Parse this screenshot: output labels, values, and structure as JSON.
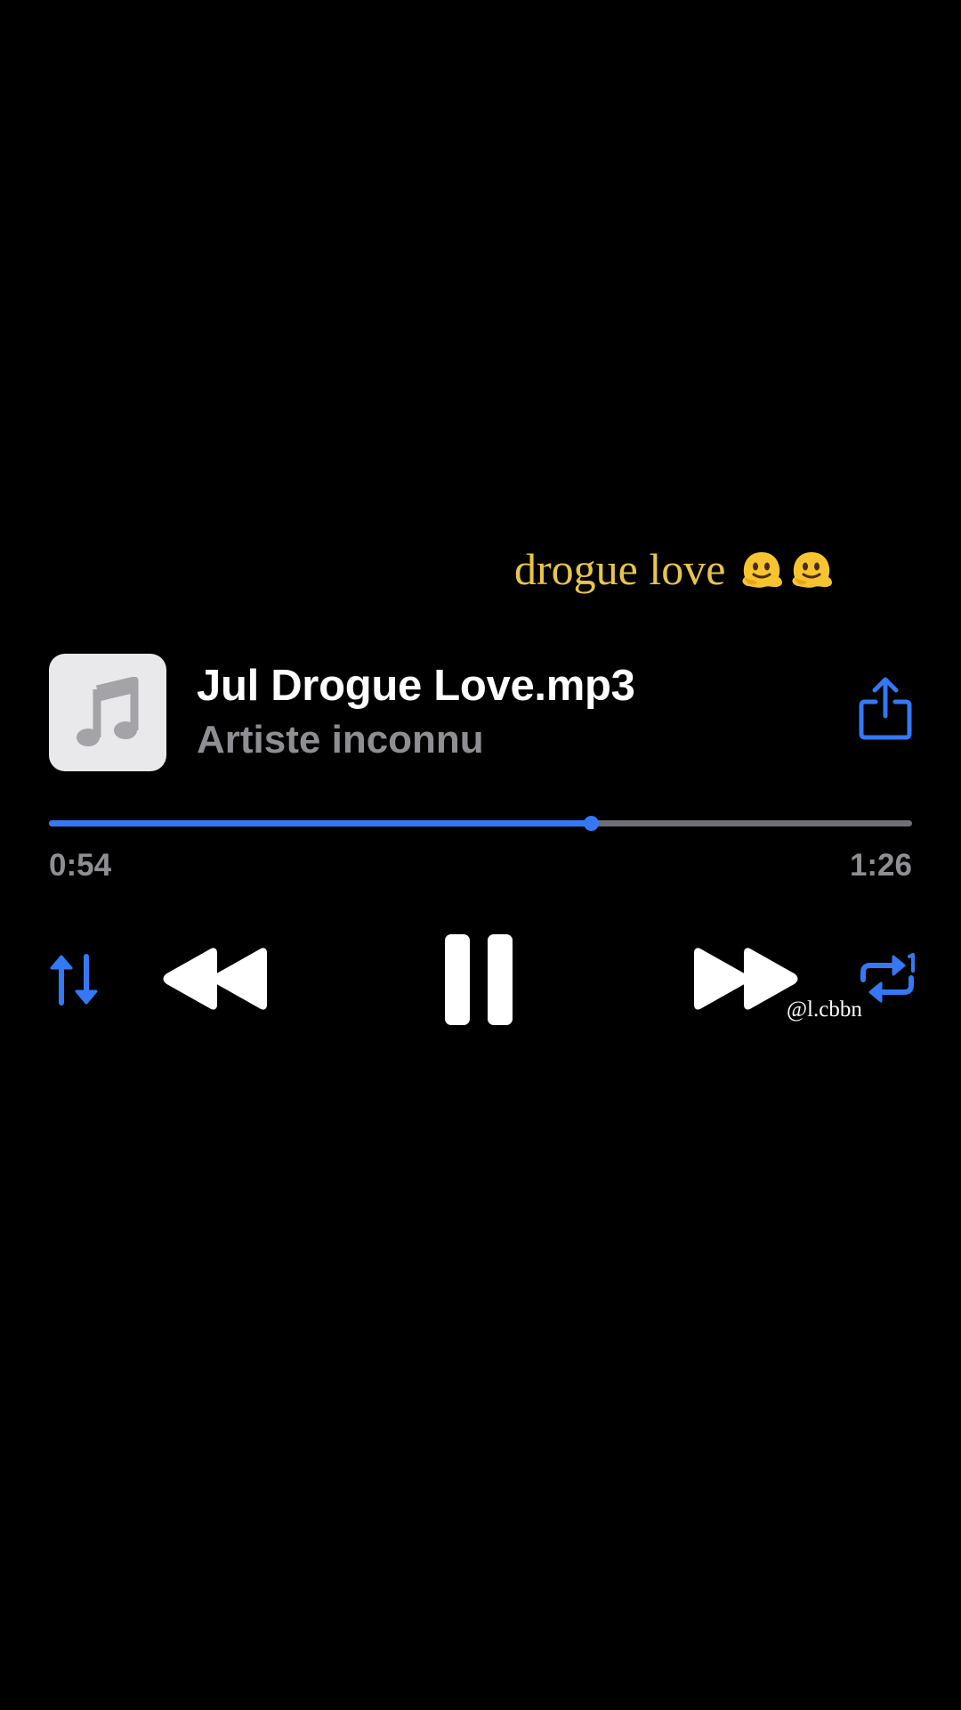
{
  "caption": {
    "text": "drogue love",
    "emoji": [
      "melting-face",
      "melting-face"
    ],
    "color": "#e8c54a"
  },
  "track": {
    "title": "Jul Drogue Love.mp3",
    "artist": "Artiste inconnu",
    "artwork_icon": "music-note-icon"
  },
  "progress": {
    "elapsed": "0:54",
    "total": "1:26",
    "fraction": 0.628
  },
  "controls": {
    "shuffle_icon": "shuffle-icon",
    "rewind_icon": "rewind-icon",
    "pause_icon": "pause-icon",
    "forward_icon": "fast-forward-icon",
    "repeat_icon": "repeat-icon",
    "share_icon": "share-icon"
  },
  "watermark": "@l.cbbn",
  "colors": {
    "accent": "#3478f6",
    "secondary_text": "#8e8e93",
    "track": "#6e6e73",
    "background": "#000000"
  }
}
